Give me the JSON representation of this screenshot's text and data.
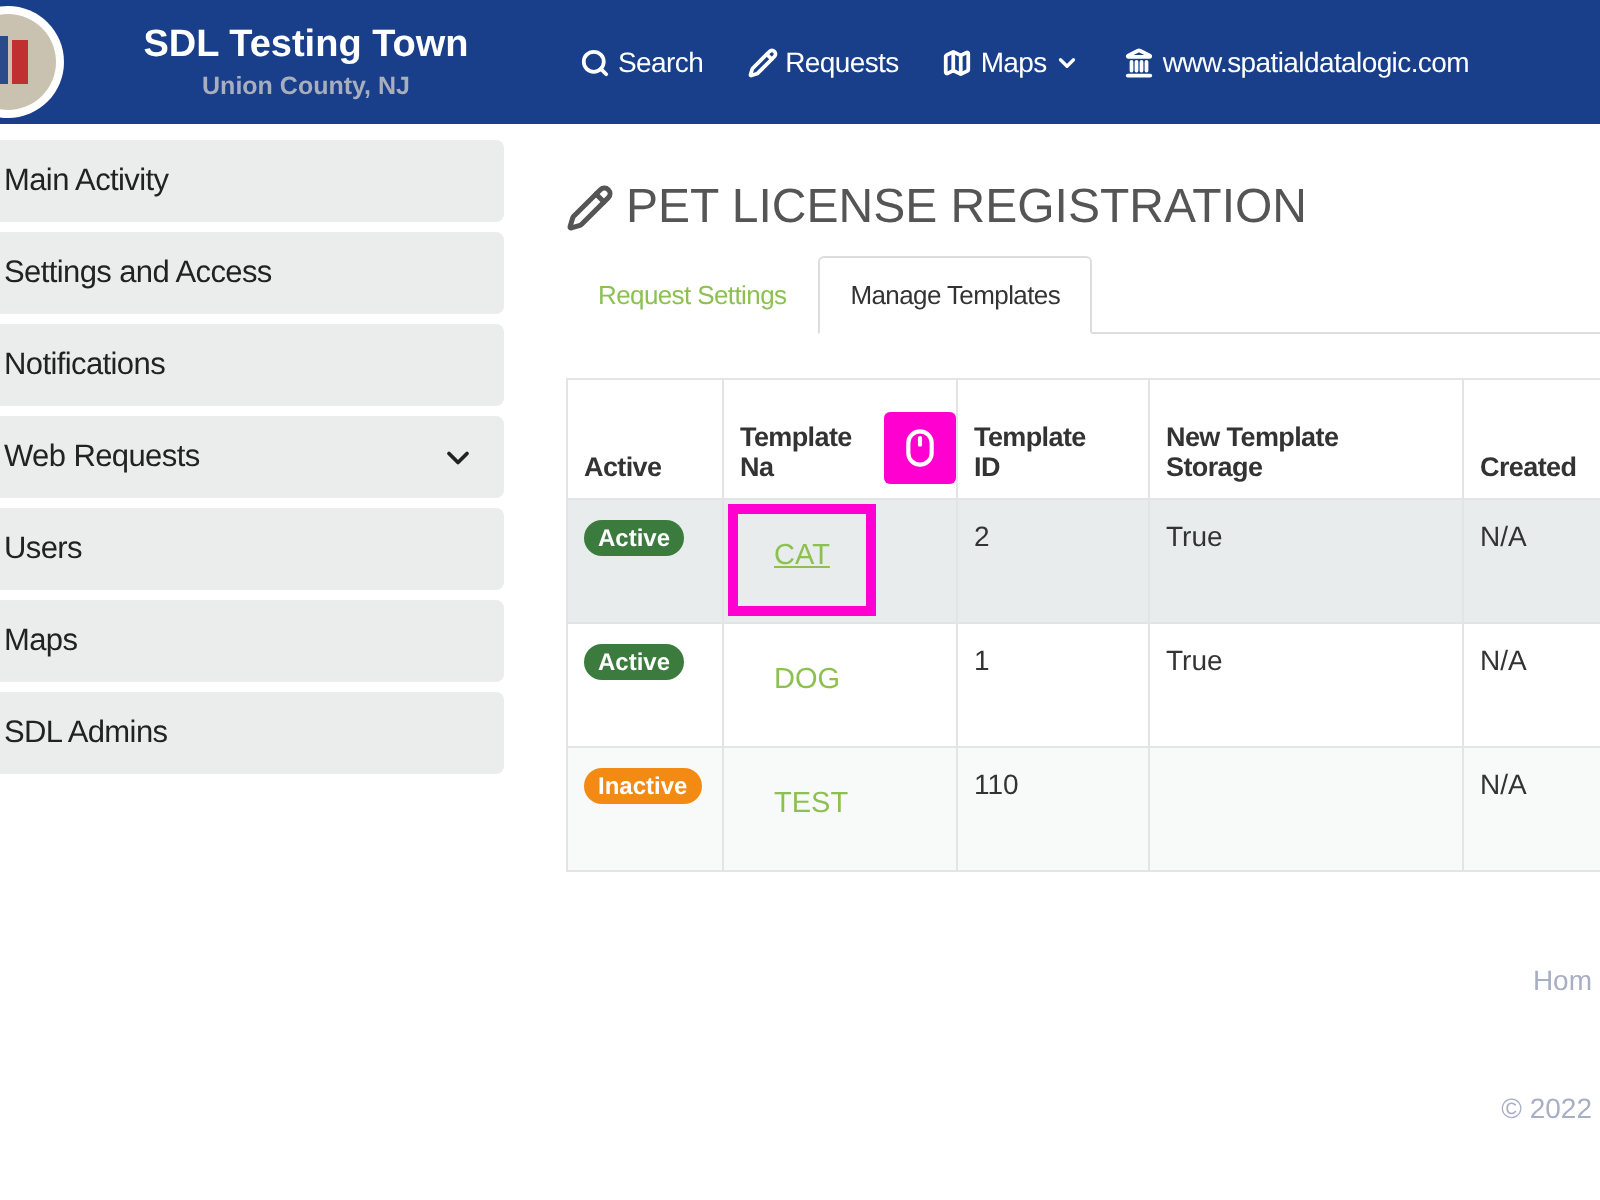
{
  "header": {
    "title": "SDL Testing Town",
    "subtitle": "Union County, NJ",
    "nav": [
      {
        "kind": "search",
        "label": "Search"
      },
      {
        "kind": "pencil",
        "label": "Requests"
      },
      {
        "kind": "map",
        "label": "Maps",
        "dropdown": true
      },
      {
        "kind": "bank",
        "label": "www.spatialdatalogic.com"
      }
    ]
  },
  "sidebar": {
    "items": [
      {
        "label": "Main Activity"
      },
      {
        "label": "Settings and Access"
      },
      {
        "label": "Notifications"
      },
      {
        "label": "Web Requests",
        "expanded": false
      },
      {
        "label": "Users"
      },
      {
        "label": "Maps"
      },
      {
        "label": "SDL Admins"
      }
    ]
  },
  "page_title": "PET LICENSE REGISTRATION",
  "tabs": [
    {
      "label": "Request Settings",
      "selected": false
    },
    {
      "label": "Manage Templates",
      "selected": true
    }
  ],
  "table": {
    "columns": [
      "Active",
      "Template Na",
      "Template ID",
      "New Template Storage",
      "Created"
    ],
    "rows": [
      {
        "status": "Active",
        "color": "#3b7b3d",
        "name": "CAT",
        "id": "2",
        "storage": "True",
        "created": "N/A",
        "hovered": true
      },
      {
        "status": "Active",
        "color": "#3b7b3d",
        "name": "DOG",
        "id": "1",
        "storage": "True",
        "created": "N/A",
        "hovered": false
      },
      {
        "status": "Inactive",
        "color": "#f28a14",
        "name": "TEST",
        "id": "110",
        "created": "N/A",
        "hovered": false
      }
    ]
  },
  "footer": {
    "link": "Hom",
    "copyright": "© 2022"
  }
}
